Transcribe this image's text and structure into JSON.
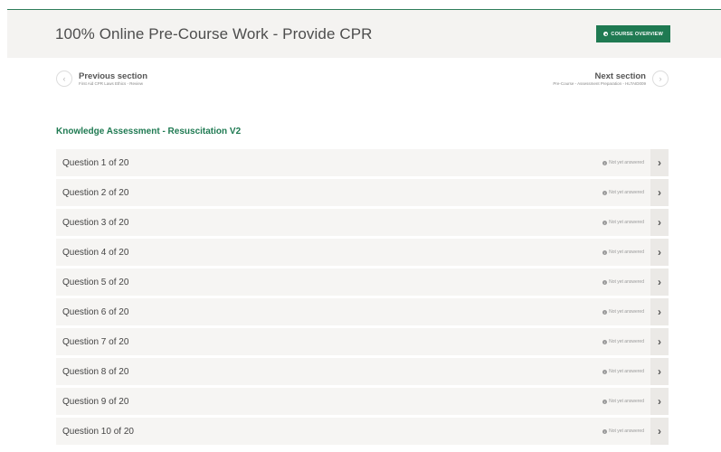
{
  "header": {
    "title": "100% Online Pre-Course Work - Provide CPR",
    "overview_button": "COURSE OVERVIEW"
  },
  "nav": {
    "prev_title": "Previous section",
    "prev_sub": "First Aid CPR Laws Ethics - Review",
    "next_title": "Next section",
    "next_sub": "Pre-Course - Assessment Preparation - HLTAID009"
  },
  "section": {
    "title": "Knowledge Assessment - Resuscitation V2"
  },
  "questions": [
    {
      "label": "Question 1 of 20",
      "status": "Not yet answered"
    },
    {
      "label": "Question 2 of 20",
      "status": "Not yet answered"
    },
    {
      "label": "Question 3 of 20",
      "status": "Not yet answered"
    },
    {
      "label": "Question 4 of 20",
      "status": "Not yet answered"
    },
    {
      "label": "Question 5 of 20",
      "status": "Not yet answered"
    },
    {
      "label": "Question 6 of 20",
      "status": "Not yet answered"
    },
    {
      "label": "Question 7 of 20",
      "status": "Not yet answered"
    },
    {
      "label": "Question 8 of 20",
      "status": "Not yet answered"
    },
    {
      "label": "Question 9 of 20",
      "status": "Not yet answered"
    },
    {
      "label": "Question 10 of 20",
      "status": "Not yet answered"
    }
  ],
  "colors": {
    "accent": "#1f7a52",
    "header_bg": "#f4f3f1",
    "row_bg": "#f6f5f3"
  },
  "icons": {
    "prev": "chevron-left-icon",
    "next": "chevron-right-icon",
    "row_arrow": "chevron-right-icon",
    "status": "info-icon"
  }
}
